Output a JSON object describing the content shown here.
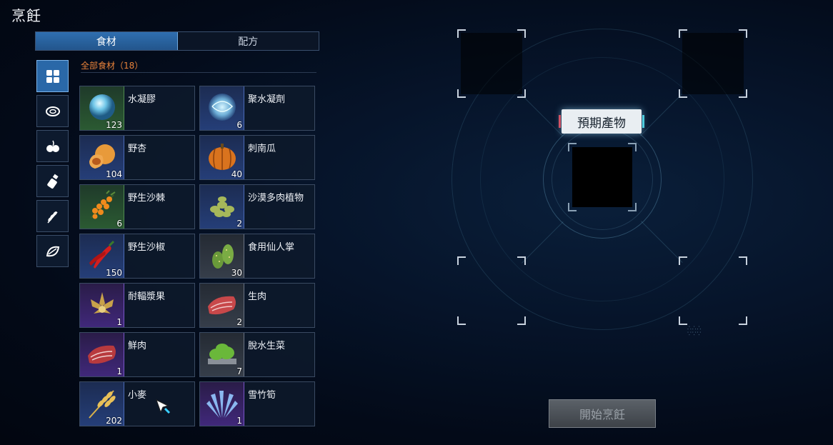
{
  "title": "烹飪",
  "tabs": [
    {
      "label": "食材",
      "active": true
    },
    {
      "label": "配方",
      "active": false
    }
  ],
  "category_icons": [
    "all-grid-icon",
    "meat-icon",
    "fruit-icon",
    "spice-icon",
    "grain-icon",
    "vegetable-icon"
  ],
  "section_label": "全部食材（18）",
  "items": [
    {
      "name": "水凝膠",
      "qty": "123",
      "rarity": "green",
      "icon": "water-gel-icon"
    },
    {
      "name": "聚水凝劑",
      "qty": "6",
      "rarity": "blue",
      "icon": "water-agent-icon"
    },
    {
      "name": "野杏",
      "qty": "104",
      "rarity": "blue",
      "icon": "apricot-icon"
    },
    {
      "name": "刺南瓜",
      "qty": "40",
      "rarity": "blue",
      "icon": "pumpkin-icon"
    },
    {
      "name": "野生沙棘",
      "qty": "6",
      "rarity": "green",
      "icon": "sea-buckthorn-icon"
    },
    {
      "name": "沙漠多肉植物",
      "qty": "2",
      "rarity": "blue",
      "icon": "succulent-icon"
    },
    {
      "name": "野生沙椒",
      "qty": "150",
      "rarity": "blue",
      "icon": "pepper-icon"
    },
    {
      "name": "食用仙人掌",
      "qty": "30",
      "rarity": "gray",
      "icon": "cactus-icon"
    },
    {
      "name": "耐輻漿果",
      "qty": "1",
      "rarity": "purple",
      "icon": "berry-icon"
    },
    {
      "name": "生肉",
      "qty": "2",
      "rarity": "gray",
      "icon": "raw-meat-icon"
    },
    {
      "name": "鮮肉",
      "qty": "1",
      "rarity": "purple",
      "icon": "fresh-meat-icon"
    },
    {
      "name": "脫水生菜",
      "qty": "7",
      "rarity": "gray",
      "icon": "lettuce-icon"
    },
    {
      "name": "小麥",
      "qty": "202",
      "rarity": "blue",
      "icon": "wheat-icon"
    },
    {
      "name": "雪竹筍",
      "qty": "1",
      "rarity": "purple",
      "icon": "snow-bamboo-icon"
    }
  ],
  "product_label": "預期產物",
  "start_button": "開始烹飪",
  "colors": {
    "accent": "#2a68a8",
    "section_label": "#e8823a"
  }
}
